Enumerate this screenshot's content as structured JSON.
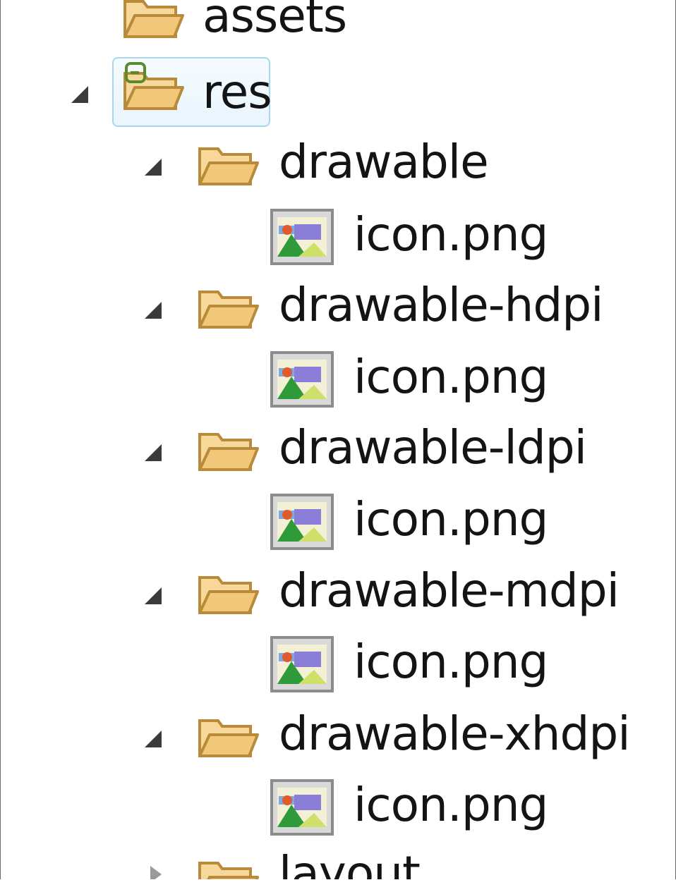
{
  "tree": {
    "assets_label": "assets",
    "res_label": "res",
    "folders": [
      {
        "label": "drawable",
        "child": "icon.png"
      },
      {
        "label": "drawable-hdpi",
        "child": "icon.png"
      },
      {
        "label": "drawable-ldpi",
        "child": "icon.png"
      },
      {
        "label": "drawable-mdpi",
        "child": "icon.png"
      },
      {
        "label": "drawable-xhdpi",
        "child": "icon.png"
      }
    ],
    "layout_label": "layout"
  },
  "colors": {
    "folder_fill": "#f3c77a",
    "folder_stroke": "#b98a3a",
    "selection_border": "#a9d6ef",
    "source_marker": "#5a8a2a"
  },
  "icons": {
    "twisty_expanded": "triangle-expanded-icon",
    "twisty_collapsed": "triangle-collapsed-icon",
    "folder": "folder-open-icon",
    "image_file": "image-file-icon",
    "source_overlay": "source-folder-overlay-icon"
  }
}
